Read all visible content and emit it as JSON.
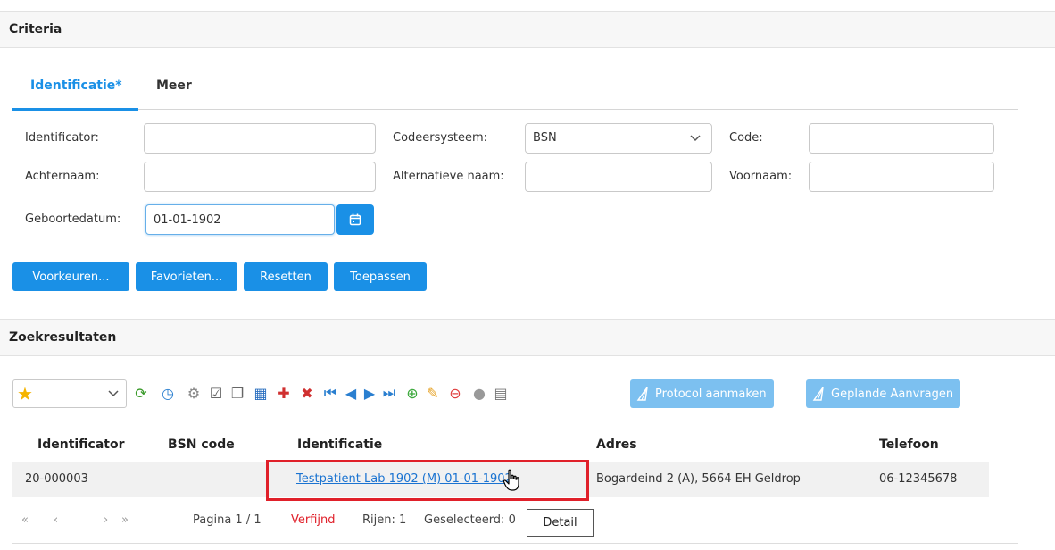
{
  "criteria": {
    "title": "Criteria",
    "tabs": [
      {
        "label": "Identificatie*",
        "active": true
      },
      {
        "label": "Meer",
        "active": false
      }
    ],
    "fields": {
      "identificator": {
        "label": "Identificator:",
        "value": ""
      },
      "codeersysteem": {
        "label": "Codeersysteem:",
        "value": "BSN"
      },
      "code": {
        "label": "Code:",
        "value": ""
      },
      "achternaam": {
        "label": "Achternaam:",
        "value": ""
      },
      "alternatieve_naam": {
        "label": "Alternatieve naam:",
        "value": ""
      },
      "voornaam": {
        "label": "Voornaam:",
        "value": ""
      },
      "geboortedatum": {
        "label": "Geboortedatum:",
        "value": "01-01-1902"
      }
    },
    "buttons": {
      "voorkeuren": "Voorkeuren...",
      "favorieten": "Favorieten...",
      "resetten": "Resetten",
      "toepassen": "Toepassen"
    }
  },
  "results": {
    "title": "Zoekresultaten",
    "toolbar": {
      "protocol_aanmaken": "Protocol aanmaken",
      "geplande_aanvragen": "Geplande Aanvragen"
    },
    "columns": [
      "Identificator",
      "BSN code",
      "Identificatie",
      "Adres",
      "Telefoon"
    ],
    "rows": [
      {
        "identificator": "20-000003",
        "bsn_code": "",
        "identificatie": "Testpatient Lab 1902 (M) 01-01-1902",
        "adres": "Bogardeind 2 (A), 5664 EH Geldrop",
        "telefoon": "06-12345678"
      }
    ],
    "pager": {
      "first": "«",
      "prev": "‹",
      "next": "›",
      "last": "»",
      "page": "Pagina 1 / 1",
      "verfijnd": "Verfijnd",
      "rijen": "Rijen: 1",
      "geselecteerd": "Geselecteerd: 0"
    },
    "tooltip": "Detail"
  },
  "colors": {
    "accent": "#1a90e6",
    "accent_light": "#7cc0f0",
    "highlight": "#e0202a",
    "link": "#1a73d1"
  }
}
